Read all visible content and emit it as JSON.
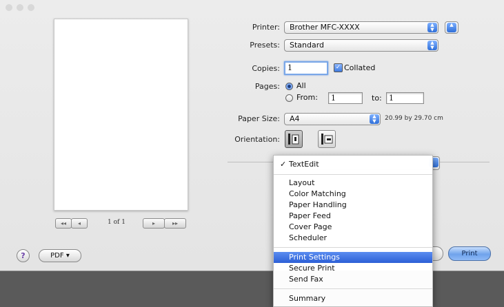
{
  "printer": {
    "label": "Printer:",
    "value": "Brother MFC-XXXX"
  },
  "presets": {
    "label": "Presets:",
    "value": "Standard"
  },
  "copies": {
    "label": "Copies:",
    "value": "1",
    "collated_label": "Collated"
  },
  "pages": {
    "label": "Pages:",
    "all_label": "All",
    "from_label": "From:",
    "from_value": "1",
    "to_label": "to:",
    "to_value": "1"
  },
  "paper_size": {
    "label": "Paper Size:",
    "value": "A4",
    "dimensions": "20.99 by 29.70 cm"
  },
  "orientation": {
    "label": "Orientation:"
  },
  "preview": {
    "page_count": "1 of 1",
    "nav_first": "◂◂",
    "nav_prev": "◂",
    "nav_next": "▸",
    "nav_last": "▸▸"
  },
  "menu": {
    "checked": "TextEdit",
    "group1": [
      "Layout",
      "Color Matching",
      "Paper Handling",
      "Paper Feed",
      "Cover Page",
      "Scheduler"
    ],
    "group2": [
      "Print Settings",
      "Secure Print",
      "Send Fax"
    ],
    "group3": [
      "Summary"
    ],
    "highlighted": "Print Settings"
  },
  "footer": {
    "help": "?",
    "pdf": "PDF ▾",
    "print": "Print"
  },
  "colors": {
    "accent": "#2c5fd6",
    "sheet": "#e8e8e8",
    "backdrop": "#5a5a5a"
  }
}
